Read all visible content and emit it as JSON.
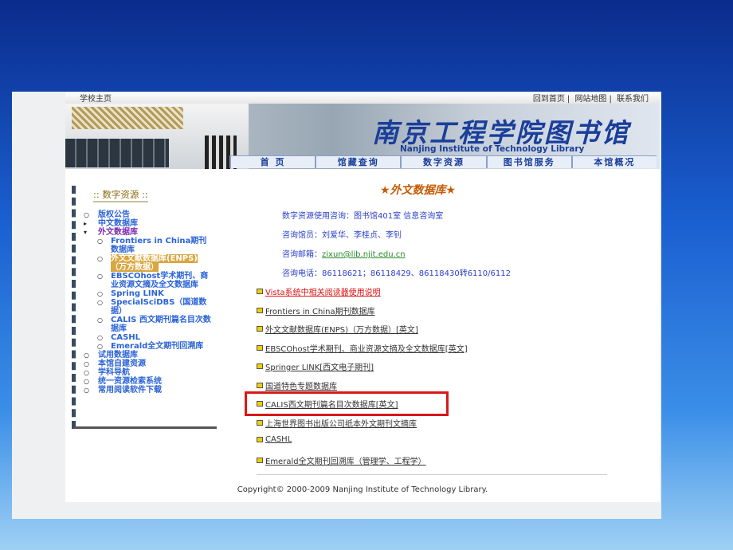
{
  "topbar": {
    "school_home": "学校主页",
    "links": [
      "回到首页",
      "网站地图",
      "联系我们"
    ],
    "sep": "|"
  },
  "banner": {
    "logo_cn": "南京工程学院图书馆",
    "logo_en": "Nanjing Institute of Technology Library"
  },
  "nav": [
    "首 页",
    "馆藏查询",
    "数字资源",
    "图书馆服务",
    "本馆概况"
  ],
  "sidebar": {
    "title": ":: 数字资源 ::",
    "items": [
      {
        "label": "版权公告",
        "level": 1,
        "bullet": "circle"
      },
      {
        "label": "中文数据库",
        "level": 1,
        "bullet": "triangle-right"
      },
      {
        "label": "外文数据库",
        "level": 1,
        "bullet": "triangle-down",
        "open": true
      },
      {
        "label": "Frontiers in China期刊数据库",
        "level": 2
      },
      {
        "label": "外文文献数据库(ENPS)（万方数据）",
        "level": 2,
        "active": true
      },
      {
        "label": "EBSCOhost学术期刊、商业资源文摘及全文数据库",
        "level": 2
      },
      {
        "label": "Spring LINK",
        "level": 2
      },
      {
        "label": "SpecialSciDBS（国道数据）",
        "level": 2
      },
      {
        "label": "CALIS 西文期刊篇名目次数据库",
        "level": 2
      },
      {
        "label": "CASHL",
        "level": 2
      },
      {
        "label": "Emerald全文期刊回溯库",
        "level": 2
      },
      {
        "label": "试用数据库",
        "level": 1
      },
      {
        "label": "本馆自建资源",
        "level": 1
      },
      {
        "label": "学科导航",
        "level": 1
      },
      {
        "label": "统一资源检索系统",
        "level": 1
      },
      {
        "label": "常用阅读软件下载",
        "level": 1
      }
    ]
  },
  "main": {
    "heading": "★外文数据库★",
    "info": {
      "consult": "数字资源使用咨询：图书馆401室 信息咨询室",
      "staff": "咨询馆员：刘爱华、李桂贞、李钊",
      "email_label": "咨询邮箱：",
      "email": "zixun@lib.njit.edu.cn",
      "phone": "咨询电话：86118621；86118429、86118430转6110/6112"
    },
    "links": [
      "Vista系统中相关阅读器使用说明",
      "Frontiers in China期刊数据库",
      "外文文献数据库(ENPS)（万方数据）[英文]",
      "EBSCOhost学术期刊、商业资源文摘及全文数据库[英文]",
      "Springer LINK[西文电子期刊]",
      "国道特色专题数据库",
      "CALIS西文期刊篇名目次数据库[英文]",
      "上海世界图书出版公司纸本外文期刊文摘库",
      "CASHL",
      "Emerald全文期刊回溯库（管理学、工程学）"
    ]
  },
  "footer": {
    "copyright": "Copyright© 2000-2009 Nanjing Institute of Technology Library."
  },
  "colors": {
    "highlight_box": "#d81818",
    "link_red": "#e01010",
    "sidebar_link": "#2a63d6",
    "heading": "#c55a00"
  }
}
